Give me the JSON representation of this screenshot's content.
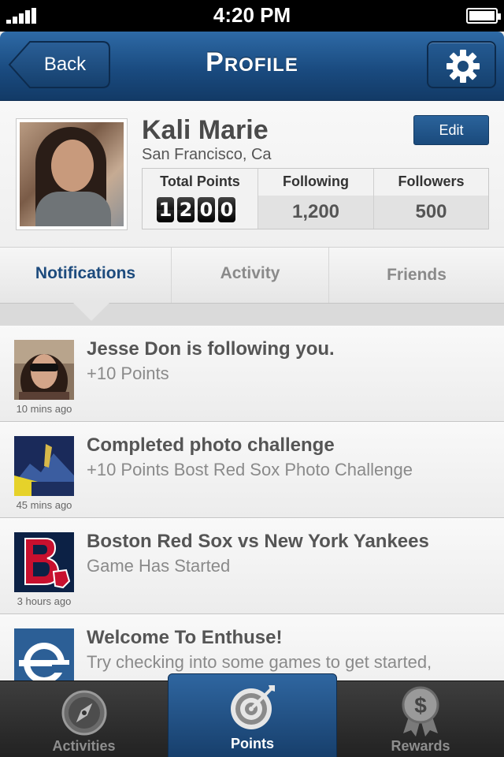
{
  "status_bar": {
    "time": "4:20 PM"
  },
  "nav": {
    "back_label": "Back",
    "title": "Profile"
  },
  "profile": {
    "name": "Kali Marie",
    "location": "San Francisco, Ca",
    "edit_label": "Edit",
    "stats": [
      {
        "label": "Total Points",
        "digits": [
          "1",
          "2",
          "0",
          "0"
        ]
      },
      {
        "label": "Following",
        "value": "1,200"
      },
      {
        "label": "Followers",
        "value": "500"
      }
    ]
  },
  "tabs": [
    "Notifications",
    "Activity",
    "Friends"
  ],
  "notifications": [
    {
      "title": "Jesse Don is following you.",
      "sub": "+10 Points",
      "time": "10 mins ago"
    },
    {
      "title": "Completed photo challenge",
      "sub": "+10 Points Bost Red Sox Photo Challenge",
      "time": "45 mins ago"
    },
    {
      "title": "Boston Red Sox vs New York Yankees",
      "sub": "Game Has Started",
      "time": "3 hours ago"
    },
    {
      "title": "Welcome To Enthuse!",
      "sub": "Try checking into some games to get started,",
      "time": ""
    }
  ],
  "tabbar": [
    "Activities",
    "Points",
    "Rewards"
  ],
  "colors": {
    "nav_blue": "#1a4b80",
    "accent_blue": "#1d4b7d"
  }
}
